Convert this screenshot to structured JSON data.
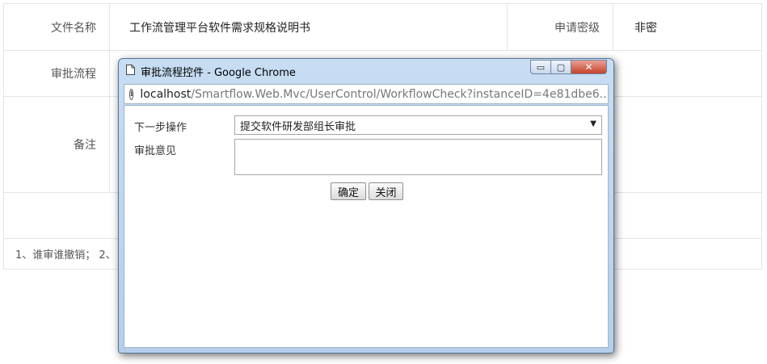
{
  "form": {
    "row1": {
      "file_name_label": "文件名称",
      "file_name_value": "工作流管理平台软件需求规格说明书",
      "security_label": "申请密级",
      "security_value": "非密"
    },
    "row2": {
      "approval_flow_label": "审批流程"
    },
    "row3": {
      "remarks_label": "备注"
    },
    "footer_text": "1、谁审谁撤销； 2、"
  },
  "popup": {
    "title": "审批流程控件 - Google Chrome",
    "window_buttons": {
      "minimize": "▭",
      "maximize": "▢",
      "close": "✕"
    },
    "address": {
      "host": "localhost",
      "path": "/Smartflow.Web.Mvc/UserControl/WorkflowCheck?instanceID=4e81dbe6..."
    },
    "next_step_label": "下一步操作",
    "next_step_selected": "提交软件研发部组长审批",
    "opinion_label": "审批意见",
    "opinion_value": "",
    "ok_button": "确定",
    "close_button": "关闭"
  }
}
